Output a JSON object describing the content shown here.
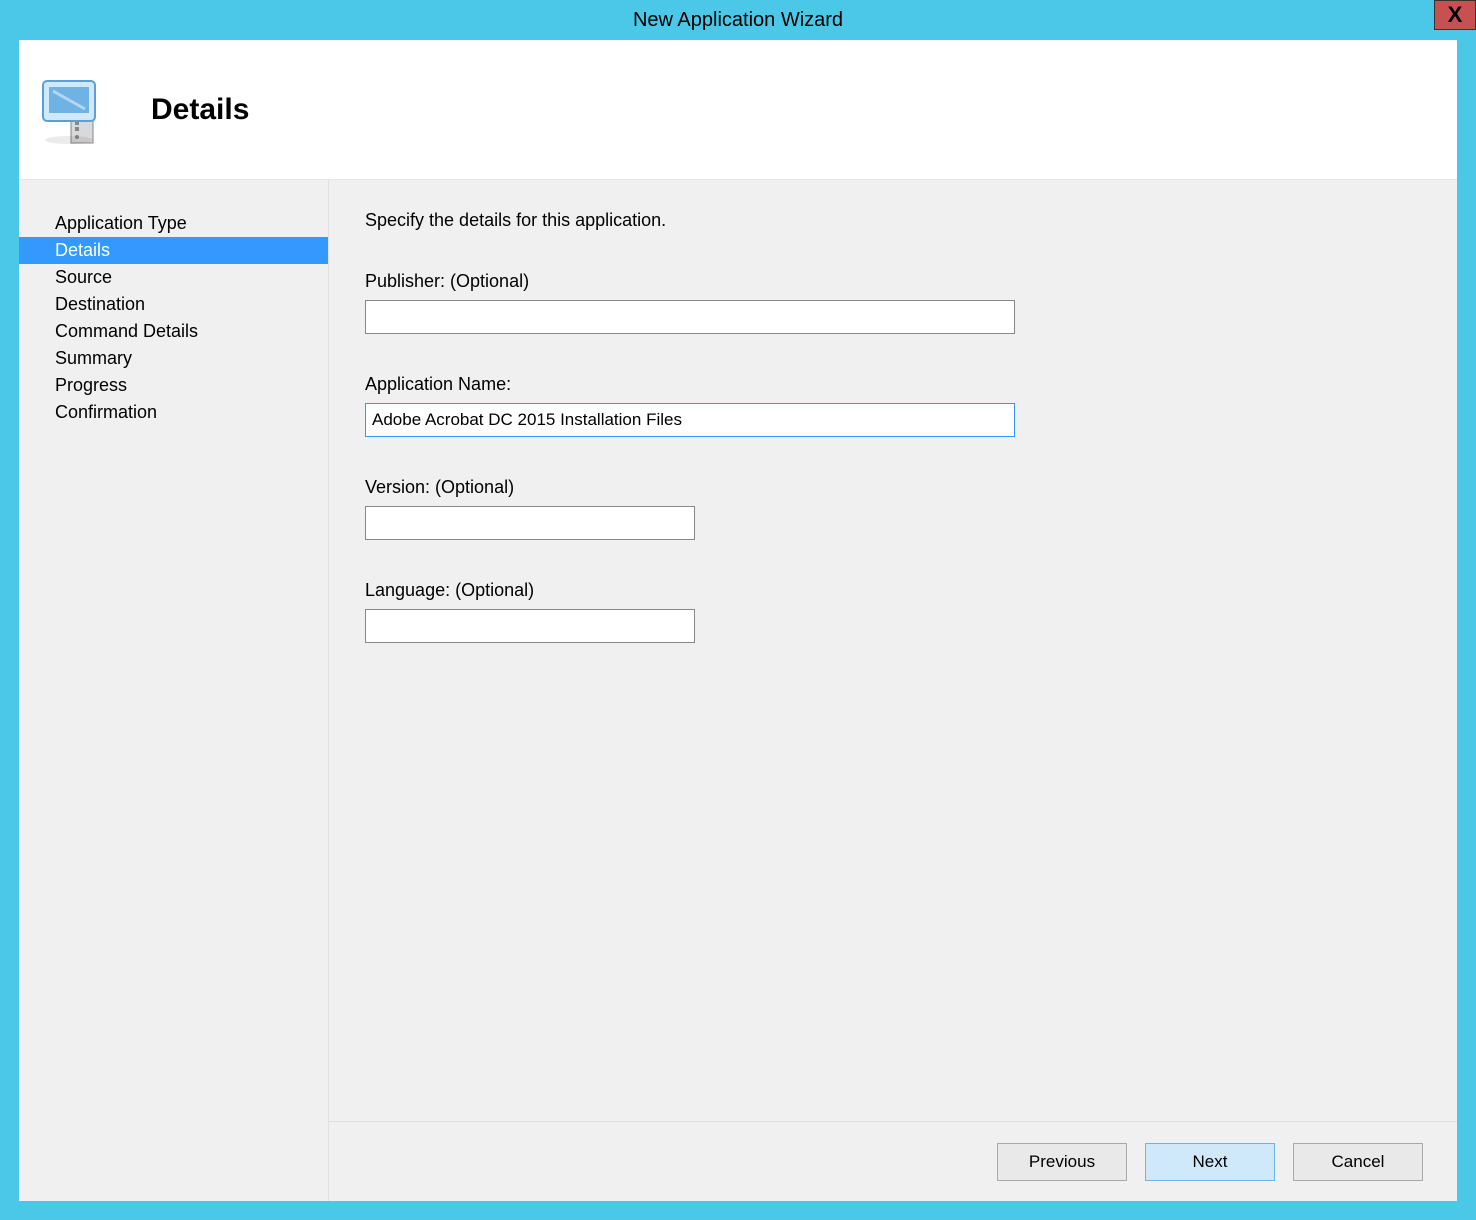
{
  "window": {
    "title": "New Application Wizard",
    "close_glyph": "X"
  },
  "header": {
    "title": "Details"
  },
  "sidebar": {
    "items": [
      {
        "label": "Application Type",
        "selected": false
      },
      {
        "label": "Details",
        "selected": true
      },
      {
        "label": "Source",
        "selected": false
      },
      {
        "label": "Destination",
        "selected": false
      },
      {
        "label": "Command Details",
        "selected": false
      },
      {
        "label": "Summary",
        "selected": false
      },
      {
        "label": "Progress",
        "selected": false
      },
      {
        "label": "Confirmation",
        "selected": false
      }
    ]
  },
  "content": {
    "instruction": "Specify the details for this application.",
    "fields": {
      "publisher": {
        "label": "Publisher: (Optional)",
        "value": ""
      },
      "appname": {
        "label": "Application Name:",
        "value": "Adobe Acrobat DC 2015 Installation Files"
      },
      "version": {
        "label": "Version: (Optional)",
        "value": ""
      },
      "language": {
        "label": "Language: (Optional)",
        "value": ""
      }
    }
  },
  "footer": {
    "previous": "Previous",
    "next": "Next",
    "cancel": "Cancel"
  }
}
